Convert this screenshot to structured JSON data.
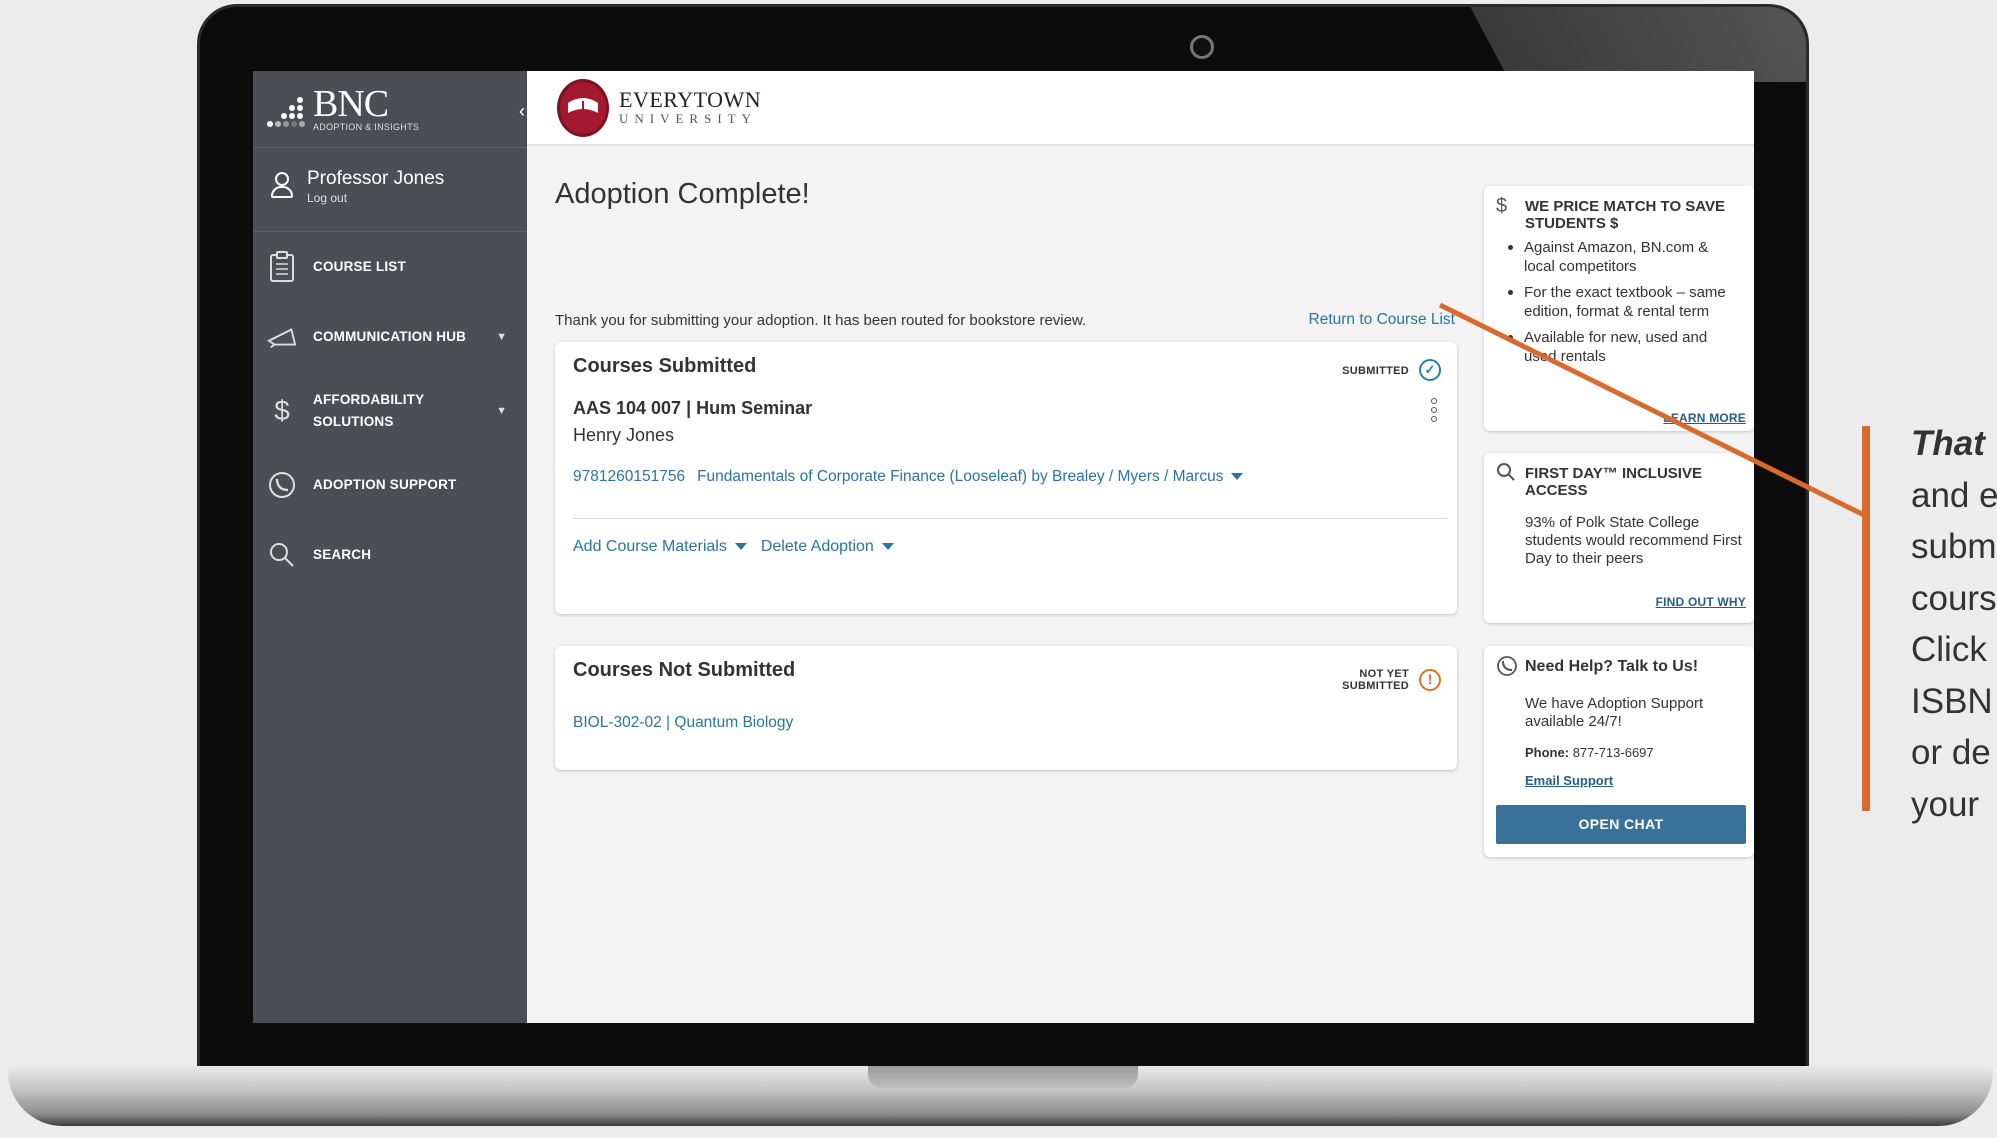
{
  "sidebar": {
    "brand_name": "BNC",
    "brand_sub": "ADOPTION & INSIGHTS",
    "user_name": "Professor Jones",
    "logout": "Log out",
    "items": [
      {
        "label": "COURSE LIST",
        "icon": "clipboard-icon"
      },
      {
        "label": "COMMUNICATION HUB",
        "icon": "megaphone-icon",
        "caret": "▼"
      },
      {
        "label": "AFFORDABILITY SOLUTIONS",
        "icon": "dollar-icon",
        "caret": "▼"
      },
      {
        "label": "ADOPTION SUPPORT",
        "icon": "whatsapp-phone-icon"
      },
      {
        "label": "SEARCH",
        "icon": "search-icon"
      }
    ]
  },
  "header": {
    "uni_name": "EVERYTOWN",
    "uni_sub": "UNIVERSITY"
  },
  "main": {
    "title": "Adoption Complete!",
    "thanks": "Thank you for submitting your adoption. It has been routed for bookstore review.",
    "return_link": "Return to Course List",
    "submitted": {
      "title": "Courses Submitted",
      "status": "SUBMITTED",
      "course": "AAS 104 007 | Hum Seminar",
      "instructor": "Henry Jones",
      "isbn": "9781260151756",
      "book": "Fundamentals of Corporate Finance (Looseleaf) by Brealey / Myers / Marcus",
      "add_materials": "Add Course Materials",
      "delete_adoption": "Delete Adoption"
    },
    "not_submitted": {
      "title": "Courses Not Submitted",
      "status_line1": "NOT YET",
      "status_line2": "SUBMITTED",
      "course": "BIOL-302-02  | Quantum Biology"
    }
  },
  "right": {
    "price_match": {
      "title": "WE PRICE MATCH TO SAVE STUDENTS $",
      "items": [
        "Against Amazon, BN.com & local competitors",
        "For the exact textbook – same edition, format & rental term",
        "Available for new, used and used rentals"
      ],
      "link": "LEARN MORE"
    },
    "first_day": {
      "title": "FIRST DAY™ INCLUSIVE ACCESS",
      "text": "93% of Polk State College students would recommend First Day to their peers",
      "link": "FIND OUT WHY"
    },
    "help": {
      "title": "Need Help? Talk to Us!",
      "text": "We have Adoption Support available 24/7!",
      "phone_label": "Phone:",
      "phone": "877-713-6697",
      "email": "Email Support",
      "button": "OPEN CHAT"
    }
  },
  "annotation": {
    "lines": [
      "That",
      "and e",
      "subm",
      "cours",
      "Click",
      "ISBN",
      "or de",
      "your"
    ]
  },
  "colors": {
    "sidebar": "#4b4f53",
    "link": "#2a74a3",
    "accent_orange": "#d86a2b",
    "brand_red": "#a3192f",
    "button": "#3a7199"
  }
}
